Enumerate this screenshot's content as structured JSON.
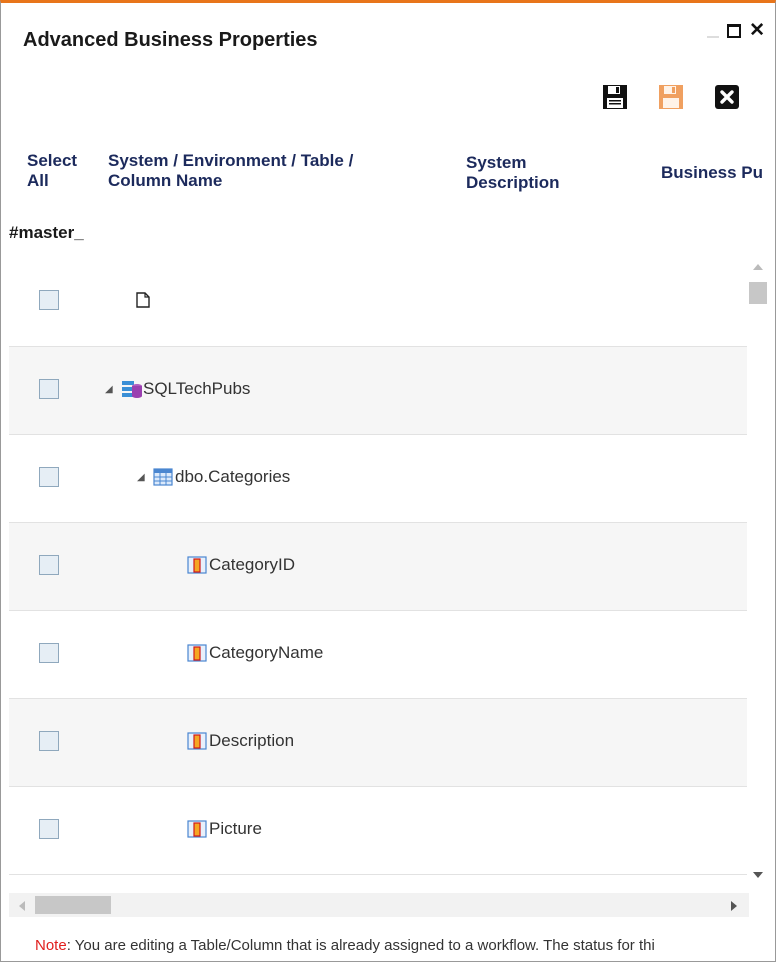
{
  "dialog": {
    "title": "Advanced Business Properties",
    "accent_color": "#e8751a"
  },
  "window_controls": {
    "minimize_icon": "minimize-icon",
    "maximize_icon": "maximize-icon",
    "close_icon": "close-icon",
    "close_glyph": "✕"
  },
  "toolbar": {
    "save_icon": "save-icon",
    "save_disabled_icon": "save-disabled-icon",
    "close_icon": "close-square-icon",
    "close_glyph": "✖"
  },
  "columns": {
    "select_all_line1": "Select",
    "select_all_line2": "All",
    "name_line1": "System / Environment / Table /",
    "name_line2": "Column Name",
    "sysdesc_line1": "System",
    "sysdesc_line2": "Description",
    "business": "Business Pu"
  },
  "filter_label": "#master_",
  "rows": [
    {
      "label": "",
      "icon": "document-icon",
      "level": 0,
      "expander": ""
    },
    {
      "label": "SQLTechPubs",
      "icon": "database-icon",
      "level": 0,
      "expander": "◢"
    },
    {
      "label": "dbo.Categories",
      "icon": "table-icon",
      "level": 1,
      "expander": "◢"
    },
    {
      "label": "CategoryID",
      "icon": "column-icon",
      "level": 2,
      "expander": ""
    },
    {
      "label": "CategoryName",
      "icon": "column-icon",
      "level": 2,
      "expander": ""
    },
    {
      "label": "Description",
      "icon": "column-icon",
      "level": 2,
      "expander": ""
    },
    {
      "label": "Picture",
      "icon": "column-icon",
      "level": 2,
      "expander": ""
    }
  ],
  "note": {
    "label": "Note",
    "text": ": You are editing a Table/Column that is already assigned to a workflow. The status for thi"
  }
}
